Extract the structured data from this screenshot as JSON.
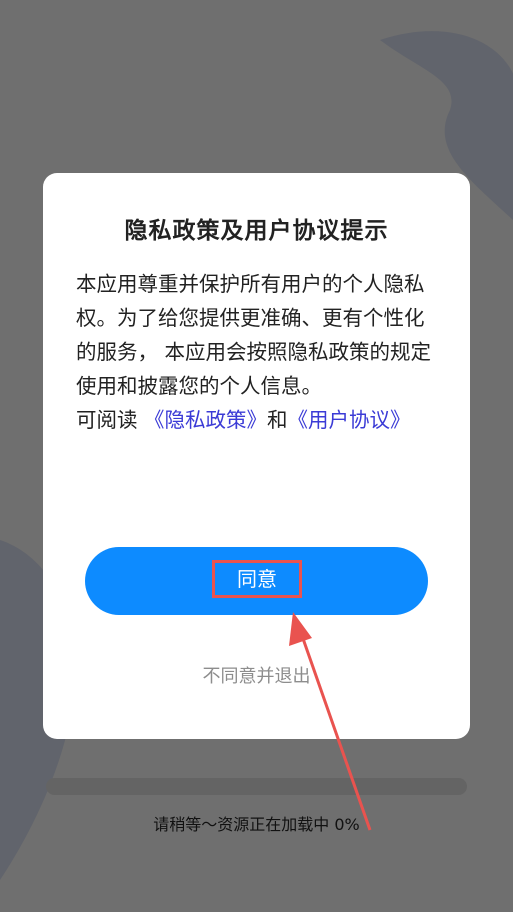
{
  "dialog": {
    "title": "隐私政策及用户协议提示",
    "paragraph": "本应用尊重并保护所有用户的个人隐私权。为了给您提供更准确、更有个性化的服务， 本应用会按照隐私政策的规定使用和披露您的个人信息。",
    "read_prefix": "可阅读 ",
    "privacy_link": "《隐私政策》",
    "connector": "和",
    "terms_link": "《用户协议》",
    "agree_label": "同意",
    "disagree_label": "不同意并退出"
  },
  "loading": {
    "text": "请稍等～资源正在加载中 0%",
    "progress_fraction": 0
  },
  "colors": {
    "accent": "#0d8bff",
    "link": "#3b3bd6",
    "annotation": "#e9534f"
  }
}
